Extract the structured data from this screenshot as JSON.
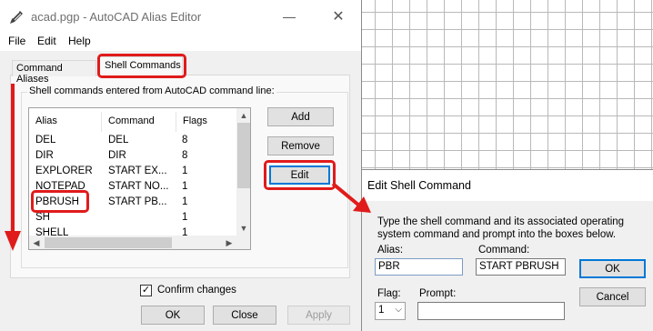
{
  "window": {
    "title": "acad.pgp - AutoCAD Alias Editor",
    "menu": [
      "File",
      "Edit",
      "Help"
    ],
    "controls": {
      "minimize": "—",
      "close": "✕"
    }
  },
  "tabs": [
    {
      "label": "Command Aliases",
      "active": false
    },
    {
      "label": "Shell Commands",
      "active": true
    }
  ],
  "group_label": "Shell commands entered from AutoCAD command line:",
  "list": {
    "headers": [
      "Alias",
      "Command",
      "Flags"
    ],
    "rows": [
      {
        "alias": "DEL",
        "command": "DEL",
        "flags": "8"
      },
      {
        "alias": "DIR",
        "command": "DIR",
        "flags": "8"
      },
      {
        "alias": "EXPLORER",
        "command": "START EX...",
        "flags": "1"
      },
      {
        "alias": "NOTEPAD",
        "command": "START NO...",
        "flags": "1"
      },
      {
        "alias": "PBRUSH",
        "command": "START PB...",
        "flags": "1"
      },
      {
        "alias": "SH",
        "command": "",
        "flags": "1"
      },
      {
        "alias": "SHELL",
        "command": "",
        "flags": "1"
      }
    ]
  },
  "buttons": {
    "add": "Add",
    "remove": "Remove",
    "edit": "Edit",
    "ok": "OK",
    "close": "Close",
    "apply": "Apply"
  },
  "confirm": {
    "label": "Confirm changes",
    "checked": true,
    "mark": "✓"
  },
  "edit_dialog": {
    "title": "Edit Shell Command",
    "description": "Type the shell command and its associated operating system command and prompt into the boxes below.",
    "alias_label": "Alias:",
    "alias_value": "PBR",
    "command_label": "Command:",
    "command_value": "START PBRUSH",
    "flag_label": "Flag:",
    "flag_value": "1",
    "prompt_label": "Prompt:",
    "prompt_value": "",
    "ok": "OK",
    "cancel": "Cancel"
  },
  "icons": {
    "scroll_up": "▲",
    "scroll_down": "▼",
    "scroll_left": "◀",
    "scroll_right": "▶",
    "dropdown": "⌵"
  },
  "colors": {
    "highlight": "#e01b1b",
    "accent": "#0078d7"
  }
}
